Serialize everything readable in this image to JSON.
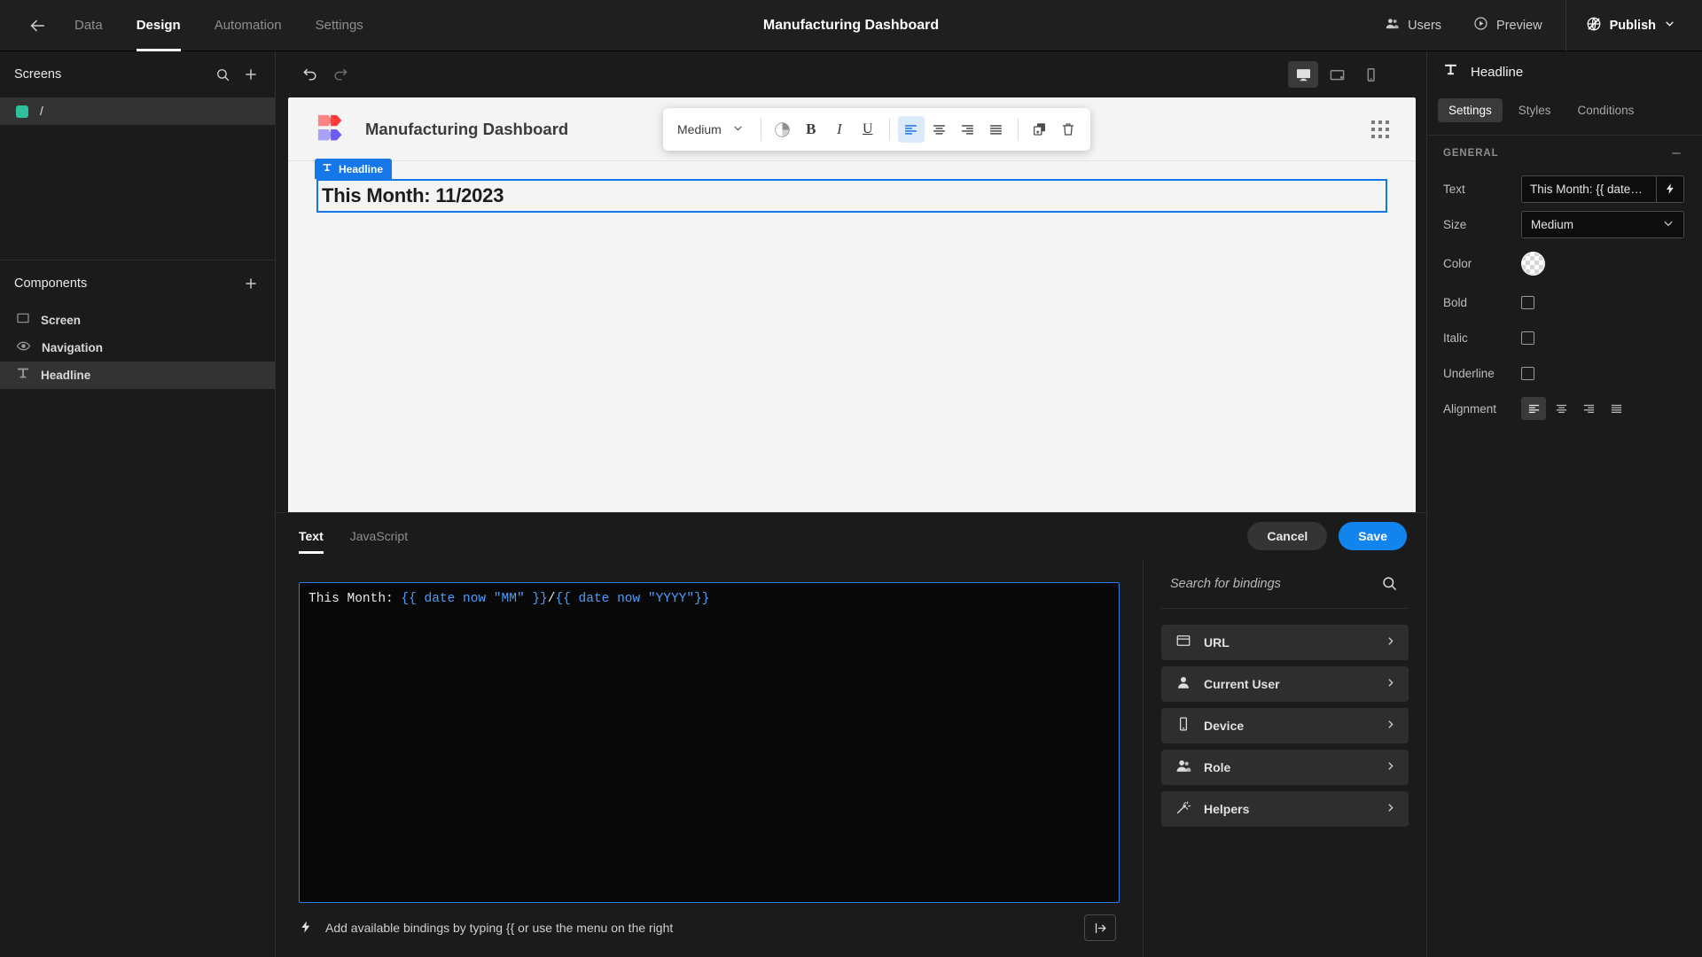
{
  "topbar": {
    "back_icon": "arrow-left-icon",
    "nav": [
      {
        "label": "Data",
        "active": false
      },
      {
        "label": "Design",
        "active": true
      },
      {
        "label": "Automation",
        "active": false
      },
      {
        "label": "Settings",
        "active": false
      }
    ],
    "app_title": "Manufacturing Dashboard",
    "users_label": "Users",
    "preview_label": "Preview",
    "publish_label": "Publish"
  },
  "sidebar": {
    "screens_title": "Screens",
    "screens": [
      {
        "label": "/",
        "color": "#2fbf9c",
        "selected": true
      }
    ],
    "components_title": "Components",
    "components": [
      {
        "label": "Screen",
        "icon": "screen-icon",
        "selected": false
      },
      {
        "label": "Navigation",
        "icon": "eye-icon",
        "selected": false
      },
      {
        "label": "Headline",
        "icon": "text-icon",
        "selected": true
      }
    ]
  },
  "canvas": {
    "devices": [
      {
        "name": "desktop",
        "active": true
      },
      {
        "name": "tablet",
        "active": false
      },
      {
        "name": "mobile",
        "active": false
      }
    ],
    "app_name": "Manufacturing Dashboard",
    "headline_badge": "Headline",
    "headline_text": "This Month: 11/2023",
    "format_toolbar": {
      "size_value": "Medium",
      "bold": "B",
      "italic": "I",
      "underline": "U",
      "alignments": [
        {
          "name": "align-left",
          "active": true
        },
        {
          "name": "align-center",
          "active": false
        },
        {
          "name": "align-right",
          "active": false
        },
        {
          "name": "align-justify",
          "active": false
        }
      ],
      "duplicate": "duplicate-icon",
      "delete": "trash-icon"
    }
  },
  "drawer": {
    "tabs": [
      {
        "label": "Text",
        "active": true
      },
      {
        "label": "JavaScript",
        "active": false
      }
    ],
    "cancel_label": "Cancel",
    "save_label": "Save",
    "code_prefix": "This Month: ",
    "code_expr_1": "{{ date now \"MM\" }}",
    "code_separator": "/",
    "code_expr_2": "{{ date now \"YYYY\"}}",
    "hint": "Add available bindings by typing {{ or use the menu on the right",
    "search_placeholder": "Search for bindings",
    "search_value": "",
    "bindings": [
      {
        "label": "URL",
        "icon": "browser-icon"
      },
      {
        "label": "Current User",
        "icon": "user-icon"
      },
      {
        "label": "Device",
        "icon": "phone-icon"
      },
      {
        "label": "Role",
        "icon": "users-icon"
      },
      {
        "label": "Helpers",
        "icon": "magic-wand-icon"
      }
    ]
  },
  "rightpanel": {
    "title": "Headline",
    "tabs": [
      {
        "label": "Settings",
        "active": true
      },
      {
        "label": "Styles",
        "active": false
      },
      {
        "label": "Conditions",
        "active": false
      }
    ],
    "section_title": "GENERAL",
    "props": {
      "text_label": "Text",
      "text_value": "This Month: {{ date…",
      "size_label": "Size",
      "size_value": "Medium",
      "color_label": "Color",
      "bold_label": "Bold",
      "italic_label": "Italic",
      "underline_label": "Underline",
      "alignment_label": "Alignment",
      "alignments": [
        {
          "name": "align-left",
          "active": true
        },
        {
          "name": "align-center",
          "active": false
        },
        {
          "name": "align-right",
          "active": false
        },
        {
          "name": "align-justify",
          "active": false
        }
      ]
    }
  },
  "colors": {
    "accent": "#1284ee",
    "selection": "#1677e8",
    "screen_dot": "#2fbf9c",
    "logo_red": "#ff4d4d",
    "logo_purple": "#6b5cf6"
  }
}
